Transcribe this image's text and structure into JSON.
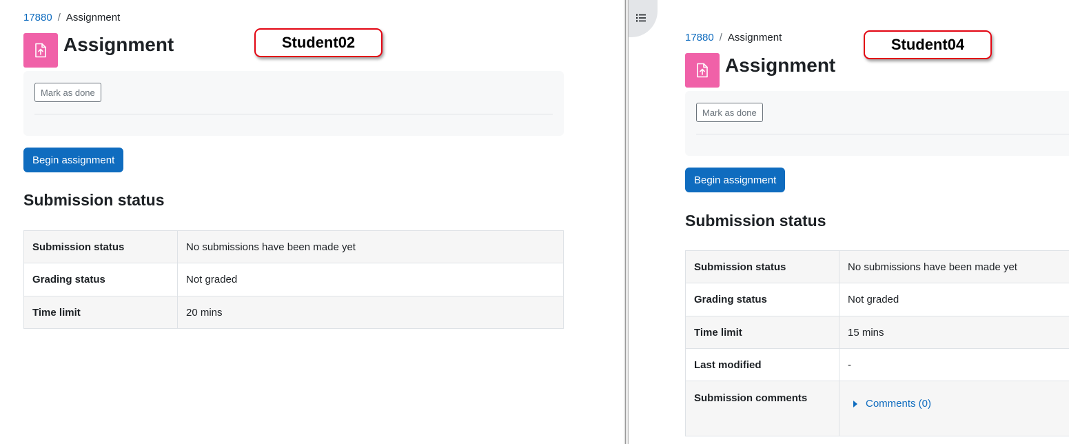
{
  "left": {
    "breadcrumb": {
      "course": "17880",
      "current": "Assignment"
    },
    "title": "Assignment",
    "badge": "Student02",
    "mark_done_label": "Mark as done",
    "begin_label": "Begin assignment",
    "section_heading": "Submission status",
    "rows": [
      {
        "label": "Submission status",
        "value": "No submissions have been made yet"
      },
      {
        "label": "Grading status",
        "value": "Not graded"
      },
      {
        "label": "Time limit",
        "value": "20 mins"
      }
    ]
  },
  "right": {
    "breadcrumb": {
      "course": "17880",
      "current": "Assignment"
    },
    "title": "Assignment",
    "badge": "Student04",
    "mark_done_label": "Mark as done",
    "begin_label": "Begin assignment",
    "section_heading": "Submission status",
    "rows": [
      {
        "label": "Submission status",
        "value": "No submissions have been made yet"
      },
      {
        "label": "Grading status",
        "value": "Not graded"
      },
      {
        "label": "Time limit",
        "value": "15 mins"
      },
      {
        "label": "Last modified",
        "value": "-"
      },
      {
        "label": "Submission comments",
        "link": "Comments (0)"
      }
    ]
  },
  "icons": {
    "module": "assignment-upload-icon",
    "index_toggle": "list-icon",
    "expand": "caret-right-icon"
  },
  "colors": {
    "link": "#0f6cbf",
    "primary_button": "#0f6cbf",
    "module_icon_bg": "#f061a8",
    "badge_border": "#e30613"
  }
}
